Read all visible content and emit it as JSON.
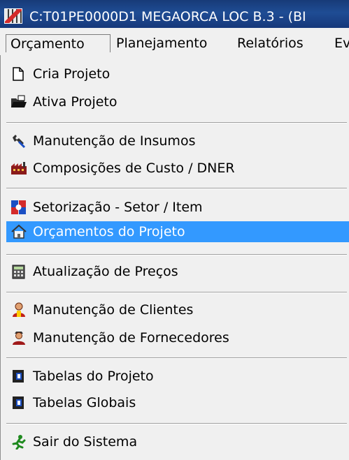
{
  "window": {
    "title": "C:T01PE0000D1 MEGAORCA LOC B.3 -  (BI"
  },
  "menubar": {
    "items": [
      {
        "label": "Orçamento"
      },
      {
        "label": "Planejamento"
      },
      {
        "label": "Relatórios"
      },
      {
        "label": "Ev"
      }
    ]
  },
  "dropdown": {
    "items": [
      {
        "label": "Cria Projeto",
        "icon": "new-document-icon"
      },
      {
        "label": "Ativa Projeto",
        "icon": "open-folder-icon"
      },
      {
        "label": "Manutenção  de Insumos",
        "icon": "wrench-icon"
      },
      {
        "label": "Composições de Custo / DNER",
        "icon": "factory-icon"
      },
      {
        "label": "Setorização - Setor / Item",
        "icon": "sector-icon"
      },
      {
        "label": "Orçamentos do Projeto",
        "icon": "house-icon",
        "highlighted": true
      },
      {
        "label": "Atualização de Preços",
        "icon": "calculator-icon"
      },
      {
        "label": "Manutenção  de Clientes",
        "icon": "client-person-icon"
      },
      {
        "label": "Manutenção  de Fornecedores",
        "icon": "supplier-person-icon"
      },
      {
        "label": "Tabelas do Projeto",
        "icon": "table-book-icon"
      },
      {
        "label": "Tabelas Globais",
        "icon": "table-book-icon"
      },
      {
        "label": "Sair do Sistema",
        "icon": "running-man-icon"
      }
    ]
  },
  "colors": {
    "highlight": "#3399ff",
    "titlebar": "#1f4c94"
  }
}
